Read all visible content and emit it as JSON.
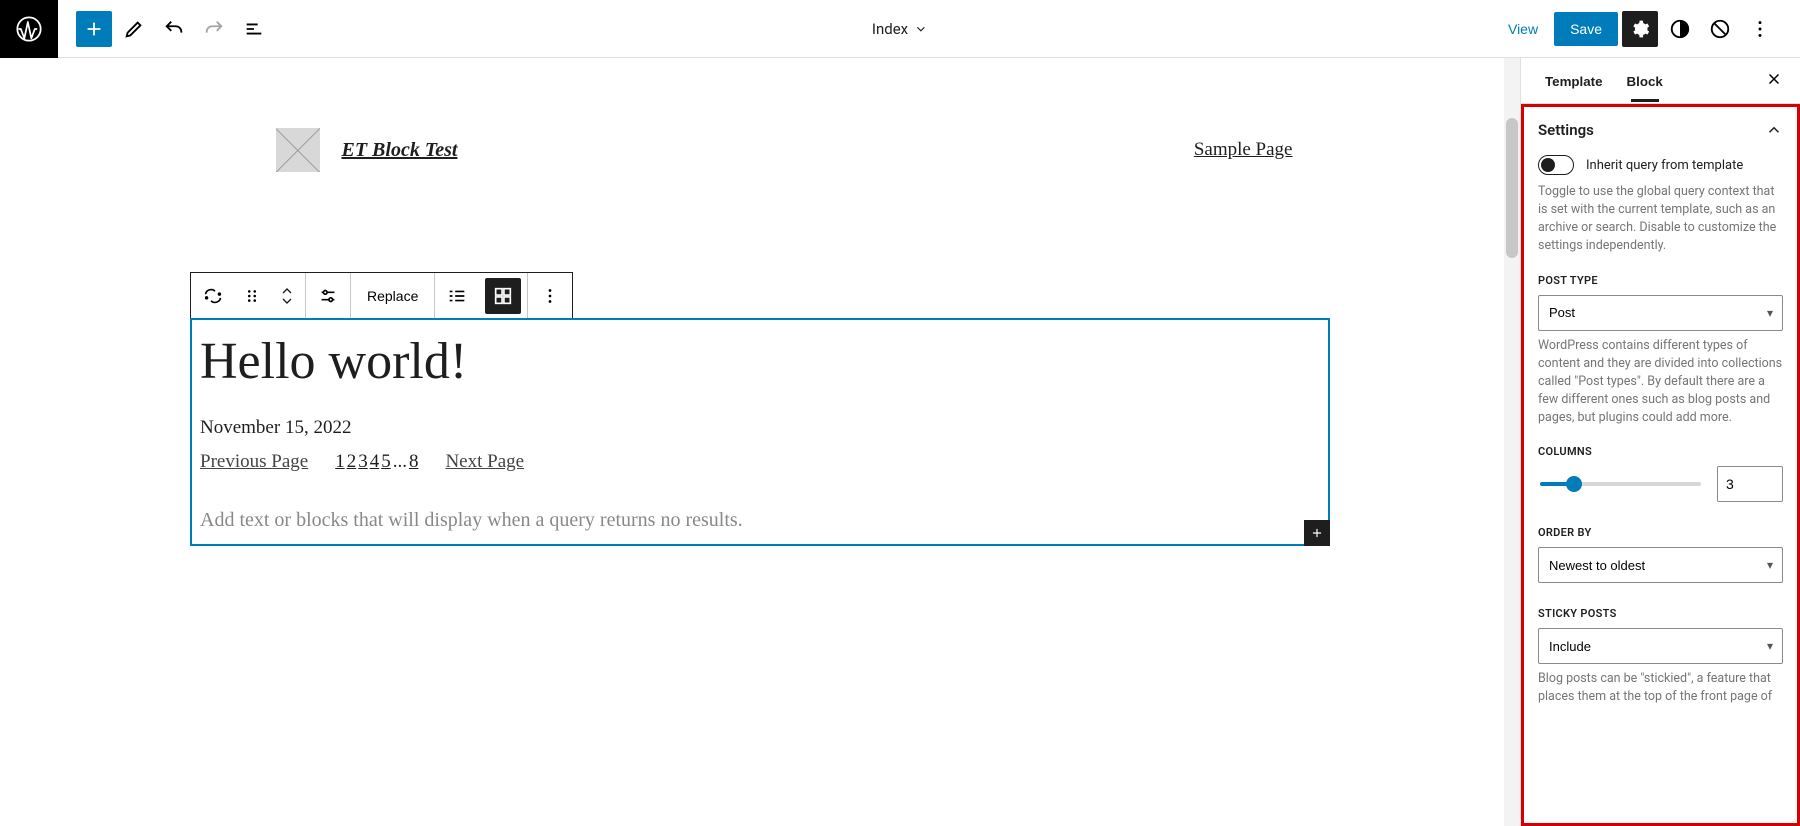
{
  "topbar": {
    "document_title": "Index",
    "view": "View",
    "save": "Save"
  },
  "site": {
    "title": "ET Block Test",
    "nav_item": "Sample Page"
  },
  "block_toolbar": {
    "replace": "Replace"
  },
  "post": {
    "title": "Hello world!",
    "date": "November 15, 2022",
    "prev": "Previous Page",
    "next": "Next Page",
    "page_numbers": [
      "1",
      "2",
      "3",
      "4",
      "5",
      "...",
      "8"
    ],
    "no_results": "Add text or blocks that will display when a query returns no results."
  },
  "sidebar": {
    "tabs": {
      "template": "Template",
      "block": "Block"
    },
    "settings_panel": "Settings",
    "inherit_label": "Inherit query from template",
    "inherit_desc": "Toggle to use the global query context that is set with the current template, such as an archive or search. Disable to customize the settings independently.",
    "post_type": {
      "label": "POST TYPE",
      "value": "Post",
      "desc": "WordPress contains different types of content and they are divided into collections called \"Post types\". By default there are a few different ones such as blog posts and pages, but plugins could add more."
    },
    "columns": {
      "label": "COLUMNS",
      "value": "3"
    },
    "order_by": {
      "label": "ORDER BY",
      "value": "Newest to oldest"
    },
    "sticky": {
      "label": "STICKY POSTS",
      "value": "Include",
      "desc": "Blog posts can be \"stickied\", a feature that places them at the top of the front page of"
    }
  }
}
